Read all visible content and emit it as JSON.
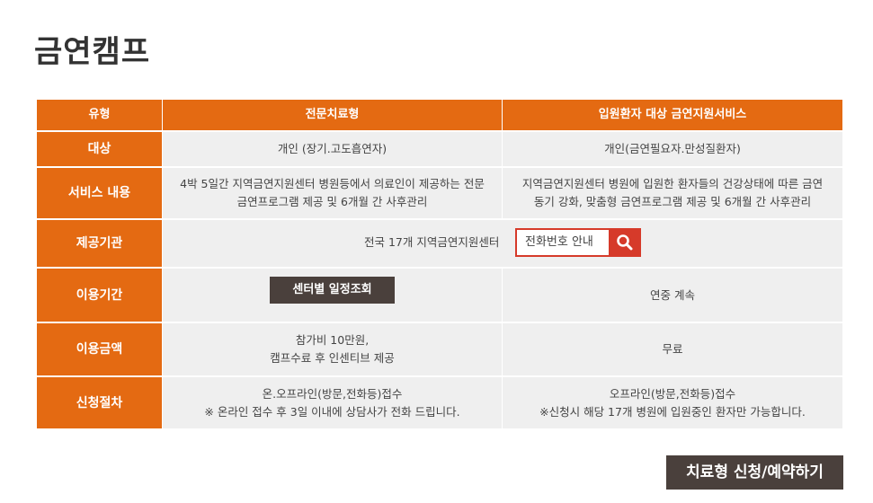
{
  "page": {
    "title": "금연캠프"
  },
  "table": {
    "header": {
      "type_label": "유형",
      "col1": "전문치료형",
      "col2": "입원환자 대상 금연지원서비스"
    },
    "rows": {
      "target": {
        "label": "대상",
        "col1": "개인 (장기.고도흡연자)",
        "col2": "개인(금연필요자.만성질환자)"
      },
      "service": {
        "label": "서비스 내용",
        "col1_line1": "4박 5일간 지역금연지원센터 병원등에서 의료인이 제공하는 전문",
        "col1_line2": "금연프로그램 제공 및 6개월 간 사후관리",
        "col2_line1": "지역금연지원센터 병원에 입원한 환자들의 건강상태에 따른 금연",
        "col2_line2": "동기 강화, 맞춤형 금연프로그램 제공 및 6개월 간 사후관리"
      },
      "provider": {
        "label": "제공기관",
        "text": "전국 17개 지역금연지원센터",
        "phone_box": "전화번호 안내"
      },
      "period": {
        "label": "이용기간",
        "col1_button": "센터별 일정조회",
        "col2": "연중 계속"
      },
      "fee": {
        "label": "이용금액",
        "col1_line1": "참가비 10만원,",
        "col1_line2": "캠프수료 후 인센티브 제공",
        "col2": "무료"
      },
      "procedure": {
        "label": "신청절차",
        "col1_line1": "온.오프라인(방문,전화등)접수",
        "col1_line2": "※ 온라인 접수 후 3일 이내에 상담사가 전화 드립니다.",
        "col2_line1": "오프라인(방문,전화등)접수",
        "col2_line2": "※신청시 해당 17개 병원에 입원중인 환자만 가능합니다."
      }
    }
  },
  "actions": {
    "apply": "치료형 신청/예약하기"
  },
  "colors": {
    "accent": "#e46a12",
    "dark_button": "#4a403c",
    "search_red": "#d63a2a",
    "cell_bg": "#efefef"
  },
  "icons": {
    "search": "search-icon"
  }
}
